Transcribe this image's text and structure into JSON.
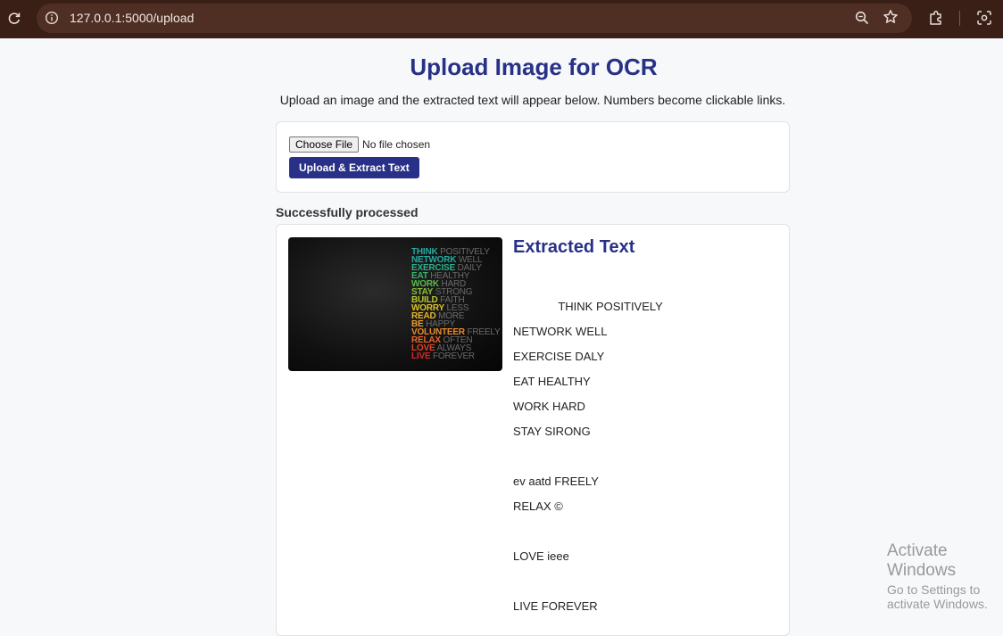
{
  "browser": {
    "url": "127.0.0.1:5000/upload",
    "icons": [
      "reload-icon",
      "info-icon",
      "zoom-icon",
      "star-icon",
      "extensions-icon",
      "lens-icon"
    ]
  },
  "page": {
    "title": "Upload Image for OCR",
    "subtitle": "Upload an image and the extracted text will appear below. Numbers become clickable links."
  },
  "upload_form": {
    "choose_file_label": "Choose File",
    "file_status": "No file chosen",
    "submit_label": "Upload & Extract Text"
  },
  "result": {
    "status": "Successfully processed",
    "heading": "Extracted Text",
    "image_words": [
      {
        "bold": "THINK",
        "light": "POSITIVELY",
        "color": "#27a9a0"
      },
      {
        "bold": "NETWORK",
        "light": "WELL",
        "color": "#27a9a0"
      },
      {
        "bold": "EXERCISE",
        "light": "DAILY",
        "color": "#2bb08a"
      },
      {
        "bold": "EAT",
        "light": "HEALTHY",
        "color": "#3bb26a"
      },
      {
        "bold": "WORK",
        "light": "HARD",
        "color": "#5ab84a"
      },
      {
        "bold": "STAY",
        "light": "STRONG",
        "color": "#8ac03a"
      },
      {
        "bold": "BUILD",
        "light": "FAITH",
        "color": "#b7c62e"
      },
      {
        "bold": "WORRY",
        "light": "LESS",
        "color": "#d8c22a"
      },
      {
        "bold": "READ",
        "light": "MORE",
        "color": "#e6b52a"
      },
      {
        "bold": "BE",
        "light": "HAPPY",
        "color": "#e9a02a"
      },
      {
        "bold": "VOLUNTEER",
        "light": "FREELY",
        "color": "#ea8a2a"
      },
      {
        "bold": "RELAX",
        "light": "OFTEN",
        "color": "#e8642a"
      },
      {
        "bold": "LOVE",
        "light": "ALWAYS",
        "color": "#e2402a"
      },
      {
        "bold": "LIVE",
        "light": "FOREVER",
        "color": "#d6262a"
      }
    ],
    "extracted_text": "              THINK POSITIVELY\nNETWORK WELL\nEXERCISE DALY\nEAT HEALTHY\nWORK HARD\nSTAY SIRONG\n\nev aatd FREELY\nRELAX ©\n\nLOVE ieee\n\nLIVE FOREVER"
  },
  "watermark": {
    "title": "Activate Windows",
    "subtitle": "Go to Settings to activate Windows."
  },
  "colors": {
    "accent": "#283087",
    "chrome": "#3a1f16"
  }
}
